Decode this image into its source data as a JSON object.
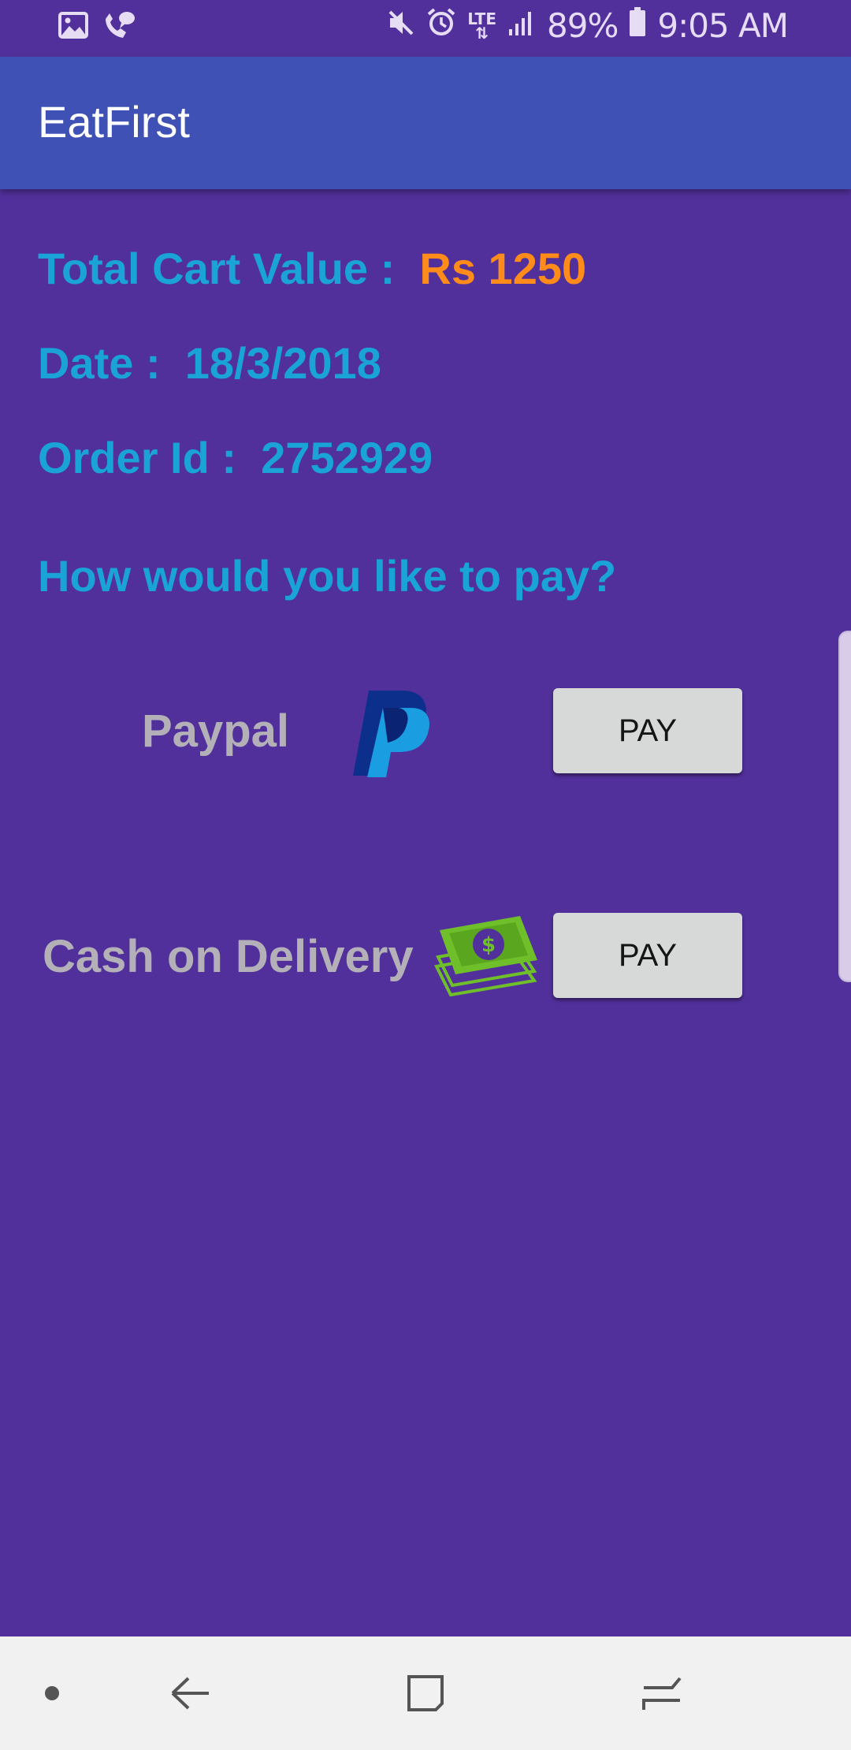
{
  "status_bar": {
    "battery": "89%",
    "time": "9:05 AM",
    "network": "LTE",
    "icons": [
      "gallery-icon",
      "wifi-calling-icon",
      "mute-icon",
      "alarm-icon",
      "lte-icon",
      "signal-icon",
      "battery-icon"
    ]
  },
  "app_bar": {
    "title": "EatFirst"
  },
  "order": {
    "total_label": "Total Cart Value :",
    "total_value": "Rs 1250",
    "date_label": "Date :",
    "date_value": "18/3/2018",
    "order_id_label": "Order Id :",
    "order_id_value": "2752929"
  },
  "payment": {
    "prompt": "How would you like to pay?",
    "options": [
      {
        "label": "Paypal",
        "icon": "paypal-logo-icon",
        "button_label": "PAY"
      },
      {
        "label": "Cash on Delivery",
        "icon": "cash-money-icon",
        "button_label": "PAY"
      }
    ]
  },
  "colors": {
    "background": "#52309c",
    "app_bar": "#3f51b5",
    "info_text": "#1aa3d6",
    "amount_text": "#ff8c1a",
    "option_label": "#b4b0b8",
    "button": "#d7d9d8"
  },
  "nav_bar": {
    "icons": [
      "dot-icon",
      "back-icon",
      "home-icon",
      "recents-icon"
    ]
  }
}
